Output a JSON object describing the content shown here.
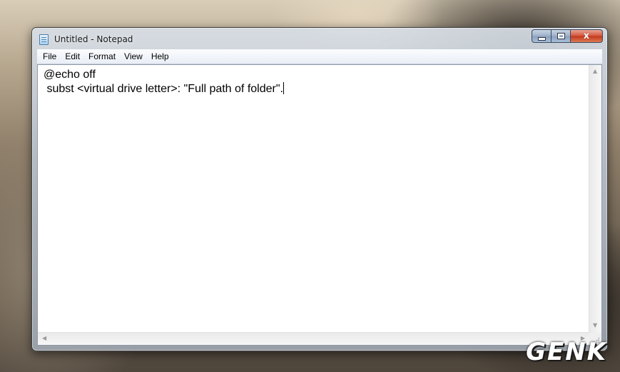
{
  "window": {
    "title": "Untitled - Notepad"
  },
  "caption_buttons": {
    "close_glyph": "x"
  },
  "menu": {
    "items": [
      "File",
      "Edit",
      "Format",
      "View",
      "Help"
    ]
  },
  "editor": {
    "lines": [
      "@echo off",
      " subst <virtual drive letter>: \"Full path of folder\"."
    ]
  },
  "watermark": "GENK"
}
